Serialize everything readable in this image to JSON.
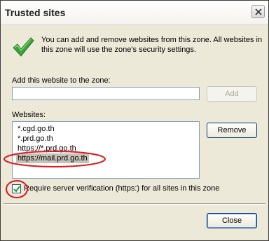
{
  "window": {
    "title": "Trusted sites"
  },
  "info": {
    "description": "You can add and remove websites from this zone. All websites in this zone will use the zone's security settings."
  },
  "add_site": {
    "label": "Add this website to the zone:",
    "value": "",
    "add_button": "Add"
  },
  "websites": {
    "label": "Websites:",
    "items": [
      "*.cgd.go.th",
      "*.prd.go.th",
      "https://*.prd.go.th",
      "https://mail.prd.go.th"
    ],
    "selected_index": 3,
    "remove_button": "Remove"
  },
  "verification": {
    "label": "Require server verification (https:) for all sites in this zone",
    "checked": true
  },
  "footer": {
    "close_button": "Close"
  },
  "colors": {
    "annotation": "#e0141e",
    "check_green": "#3aa33a"
  }
}
